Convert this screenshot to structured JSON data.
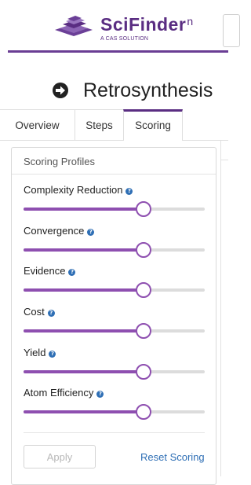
{
  "header": {
    "brand": "SciFinder",
    "brand_superscript": "n",
    "tagline": "A CAS SOLUTION",
    "brand_color": "#5a2d82"
  },
  "page": {
    "title": "Retrosynthesis",
    "title_icon": "arrow-circle-right-icon"
  },
  "tabs": [
    {
      "label": "Overview",
      "active": false
    },
    {
      "label": "Steps",
      "active": false
    },
    {
      "label": "Scoring",
      "active": true
    }
  ],
  "scoring": {
    "panel_title": "Scoring Profiles",
    "sliders": [
      {
        "label": "Complexity Reduction",
        "value_percent": 66
      },
      {
        "label": "Convergence",
        "value_percent": 66
      },
      {
        "label": "Evidence",
        "value_percent": 66
      },
      {
        "label": "Cost",
        "value_percent": 66
      },
      {
        "label": "Yield",
        "value_percent": 66
      },
      {
        "label": "Atom Efficiency",
        "value_percent": 66
      }
    ],
    "info_icon": "info-icon",
    "apply_label": "Apply",
    "reset_label": "Reset Scoring",
    "accent_color": "#8e4fb0",
    "link_color": "#2f6fb5"
  }
}
